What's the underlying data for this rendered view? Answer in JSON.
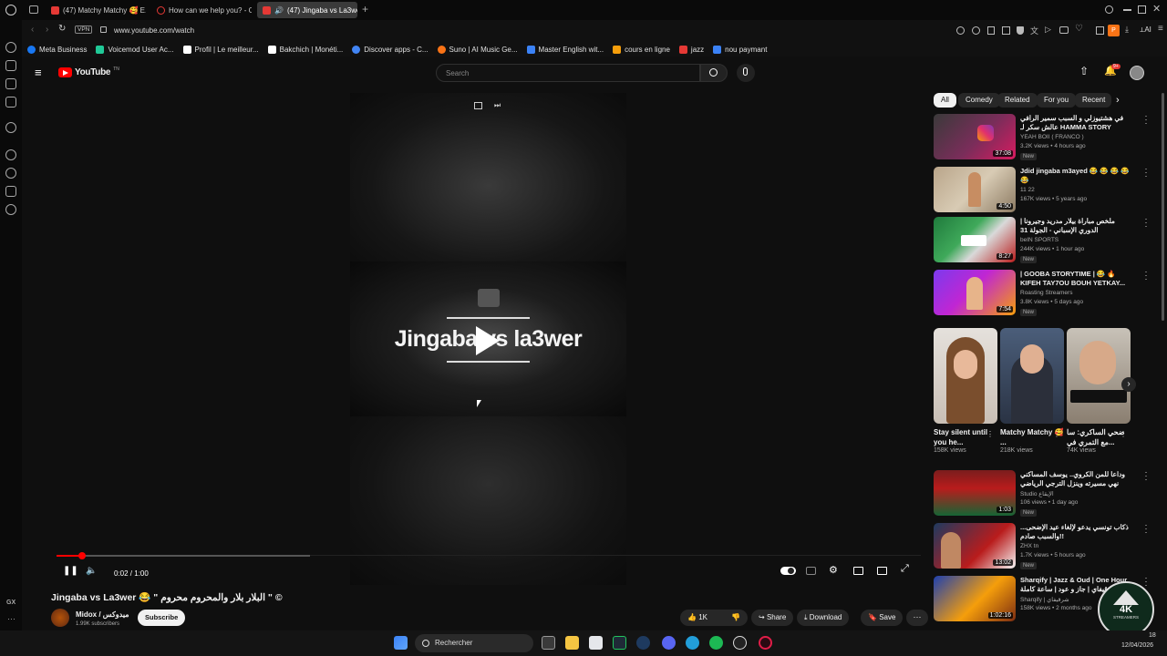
{
  "tabs": [
    {
      "title": "(47) Matchy Matchy 🥰 E...",
      "color": "#e53935"
    },
    {
      "title": "How can we help you? - C...",
      "color": "#e53935"
    },
    {
      "title": "(47) Jingaba vs La3wer",
      "color": "#e53935",
      "active": true
    }
  ],
  "address": {
    "vpn": "VPN",
    "url": "www.youtube.com/watch"
  },
  "bookmarks": [
    {
      "label": "Meta Business",
      "color": "#1877f2"
    },
    {
      "label": "Voicemod User Ac...",
      "color": "#20c997"
    },
    {
      "label": "Profil | Le meilleur...",
      "color": "#ffffff"
    },
    {
      "label": "Bakchich | Monéti...",
      "color": "#ffffff"
    },
    {
      "label": "Discover apps - C...",
      "color": "#4285f4"
    },
    {
      "label": "Suno | AI Music Ge...",
      "color": "#f97316"
    },
    {
      "label": "Master English wit...",
      "color": "#3b82f6"
    },
    {
      "label": "cours en ligne",
      "color": "#f59e0b"
    },
    {
      "label": "jazz",
      "color": "#e53935"
    },
    {
      "label": "nou paymant",
      "color": "#3b82f6"
    }
  ],
  "youtube": {
    "logo": "YouTube",
    "logo_sup": "TN",
    "search_placeholder": "Search",
    "chips": [
      "All",
      "Comedy",
      "Related",
      "For you",
      "Recent"
    ],
    "notif_badge": "9+"
  },
  "player": {
    "overlay_title": "Jingaba vs la3wer",
    "time": "0:02 / 1:00",
    "progress": 0.03
  },
  "video": {
    "title": "Jingaba vs La3wer 😂 \" البلار بلار والمحروم محروم \" ©",
    "channel": "Midox / ميدوكس",
    "subscribers": "1.99K subscribers",
    "subscribe": "Subscribe",
    "likes": "1K",
    "share": "Share",
    "download": "Download",
    "save": "Save"
  },
  "recs": [
    {
      "title": "في هشتيوزلي و السبب سمير الرافي عالش سكر لـ HAMMA STORY",
      "channel": "YEAH BOII ( FRANCO )",
      "meta": "3.2K views • 4 hours ago",
      "badge": "New",
      "duration": "37:08"
    },
    {
      "title": "Jdid jingaba m3ayed 😂 😂 😂 😂 😂",
      "channel": "11 22",
      "meta": "167K views • 5 years ago",
      "badge": "",
      "duration": "4:50"
    },
    {
      "title": "ملخص مباراة بيلار مدريد وجيرونا | الدوري الإسباني - الجولة 31",
      "channel": "beIN SPORTS",
      "meta": "244K views • 1 hour ago",
      "badge": "New",
      "duration": "8:27"
    },
    {
      "title": "| GOOBA STORYTIME | 😂 🔥 KIFEH TAY7OU BOUH YETKAY...",
      "channel": "Roasting Streamers",
      "meta": "3.8K views • 5 days ago",
      "badge": "New",
      "duration": "7:54"
    }
  ],
  "shorts": [
    {
      "title": "Stay silent until you he...",
      "views": "158K views"
    },
    {
      "title": "Matchy Matchy 🥰 ...",
      "views": "218K views"
    },
    {
      "title": "ضحي الساكري: سا مع التمري في...",
      "views": "74K views"
    }
  ],
  "recs2": [
    {
      "title": "وداعا للمن الكروي.. يوسف المساكني نهي مسيرته وينزل الترجي الرياضي التونسي في",
      "channel": "Studio الإيقاع",
      "meta": "106 views • 1 day ago",
      "badge": "New",
      "duration": "1:03"
    },
    {
      "title": "ذكاب تونسي يدعو لإلغاء عيد الإضحى... والسبب صادم!!",
      "channel": "ZHX tn",
      "meta": "1.7K views • 5 hours ago",
      "badge": "New",
      "duration": "13:02"
    },
    {
      "title": "Sharqify | Jazz & Oud | One Hour شرقيفاي | جاز و عود | ساعة كاملة",
      "channel": "Sharqify | شرقيفاي",
      "meta": "158K views • 2 months ago",
      "badge": "",
      "duration": "1:02:16"
    }
  ],
  "taskbar": {
    "search": "Rechercher",
    "clock_time": "18",
    "clock_date": "12/04/2026"
  },
  "overlay_logo": {
    "text": "4K",
    "sub": "STREAMERS"
  }
}
